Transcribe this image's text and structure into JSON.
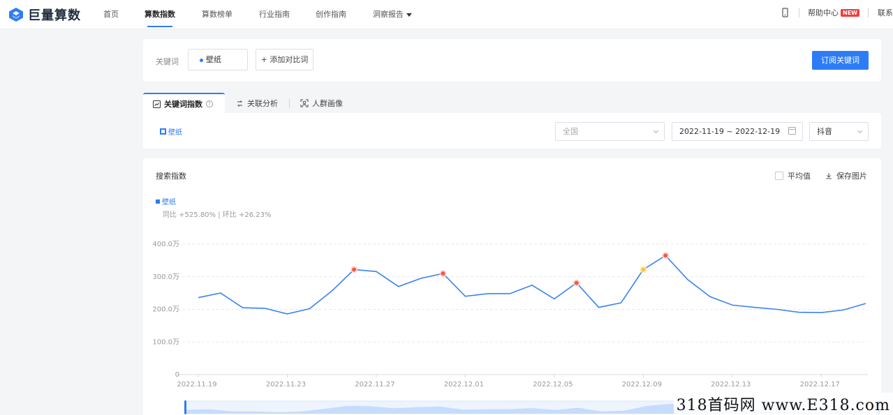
{
  "nav": {
    "logo_text": "巨量算数",
    "items": [
      {
        "label": "首页",
        "active": false
      },
      {
        "label": "算数指数",
        "active": true
      },
      {
        "label": "算数榜单",
        "active": false
      },
      {
        "label": "行业指南",
        "active": false
      },
      {
        "label": "创作指南",
        "active": false
      },
      {
        "label": "洞察报告",
        "active": false
      }
    ],
    "help": "帮助中心",
    "help_badge": "NEW",
    "cut_label": "联系"
  },
  "keyword_bar": {
    "label": "关键词",
    "keyword": "壁纸",
    "add_compare": "+ 添加对比词",
    "subscribe": "订阅关键词"
  },
  "tabs": [
    {
      "label": "关键词指数",
      "active": true
    },
    {
      "label": "关联分析",
      "active": false
    },
    {
      "label": "人群画像",
      "active": false
    }
  ],
  "filters": {
    "legend_keyword": "壁纸",
    "region": "全国",
    "date_range": "2022-11-19 ~ 2022-12-19",
    "platform": "抖音"
  },
  "chart_section": {
    "title": "搜索指数",
    "average_label": "平均值",
    "save_label": "保存图片",
    "yoy_text": "同比 +525.80% | 环比 +26.23%"
  },
  "chart_data": {
    "type": "line",
    "title": "搜索指数",
    "x": [
      "2022-11-19",
      "2022-11-20",
      "2022-11-21",
      "2022-11-22",
      "2022-11-23",
      "2022-11-24",
      "2022-11-25",
      "2022-11-26",
      "2022-11-27",
      "2022-11-28",
      "2022-11-29",
      "2022-11-30",
      "2022-12-01",
      "2022-12-02",
      "2022-12-03",
      "2022-12-04",
      "2022-12-05",
      "2022-12-06",
      "2022-12-07",
      "2022-12-08",
      "2022-12-09",
      "2022-12-10",
      "2022-12-11",
      "2022-12-12",
      "2022-12-13",
      "2022-12-14",
      "2022-12-15",
      "2022-12-16",
      "2022-12-17",
      "2022-12-18",
      "2022-12-19"
    ],
    "x_tick_labels": [
      "2022.11.19",
      "2022.11.23",
      "2022.11.27",
      "2022.12.01",
      "2022.12.05",
      "2022.12.09",
      "2022.12.13",
      "2022.12.17"
    ],
    "x_tick_indices": [
      0,
      4,
      8,
      12,
      16,
      20,
      24,
      28
    ],
    "series": [
      {
        "name": "壁纸",
        "color": "#3b82f0",
        "values": [
          236,
          250,
          205,
          203,
          186,
          202,
          256,
          322,
          316,
          270,
          295,
          310,
          240,
          248,
          248,
          274,
          232,
          281,
          206,
          220,
          322,
          365,
          291,
          239,
          213,
          206,
          200,
          191,
          190,
          198,
          218
        ],
        "highlight_red": [
          7,
          11,
          17,
          21
        ],
        "highlight_yellow": [
          20
        ]
      }
    ],
    "y_tick_labels": [
      "0",
      "100.0万",
      "200.0万",
      "300.0万",
      "400.0万"
    ],
    "y_ticks": [
      0,
      100,
      200,
      300,
      400
    ],
    "ylim": [
      0,
      400
    ],
    "ylabel": "",
    "grid": true,
    "legend": "top-left"
  },
  "watermark": "318首码网 www.E318.com"
}
